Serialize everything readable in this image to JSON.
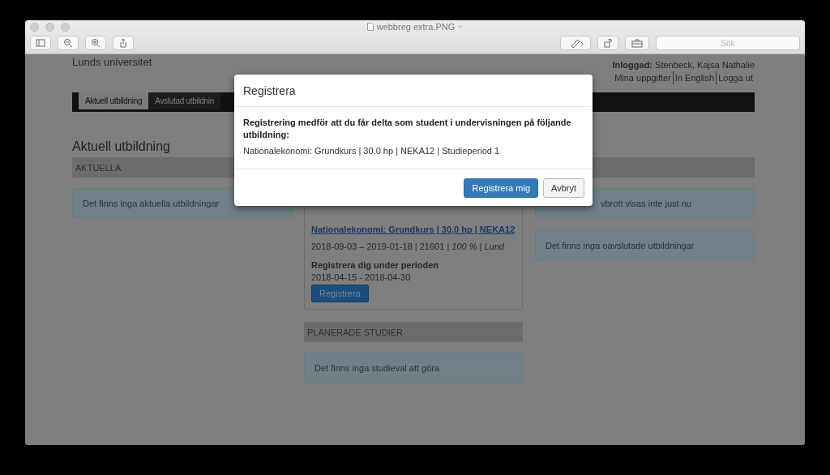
{
  "window": {
    "title": "webbreg extra.PNG",
    "search": {
      "placeholder": "Sök"
    }
  },
  "page": {
    "site_title": "Lunds universitet",
    "login": {
      "text": "**Inloggad:** Stenbeck, Kajsa Nathalie",
      "links": [
        "Mina uppgifter",
        "In English",
        "Logga ut"
      ]
    },
    "tabs": [
      {
        "label": "Aktuell utbildning",
        "selected": true
      },
      {
        "label": "Avslutad utbildnin",
        "selected": false
      }
    ],
    "heading": "Aktuell utbildning",
    "left": {
      "header": "AKTUELLA",
      "notice": "Det finns inga aktuella utbildningar"
    },
    "center": {
      "course": {
        "link": "Nationalekonomi: Grundkurs | 30,0 hp | NEKA12",
        "details": "2018-09-03 – 2019-01-18 | 21601 | *100 %* | *Lund*",
        "period_label": "Registrera dig under perioden",
        "period": "2018-04-15 - 2018-04-30",
        "button": "Registrera"
      },
      "header": "PLANERADE STUDIER",
      "notice": "Det finns inga studieval att göra"
    },
    "right": {
      "notices": [
        "vbrott visas inte just nu",
        "Det finns inga oavslutade utbildningar"
      ]
    }
  },
  "modal": {
    "title": "Registrera",
    "lead": "Registrering medför att du får delta som student i undervisningen på följande utbildning:",
    "course": "Nationalekonomi: Grundkurs | 30.0 hp | NEKA12 | Studieperiod 1",
    "buttons": [
      {
        "label": "Registrera mig",
        "kind": "primary"
      },
      {
        "label": "Avbryt",
        "kind": "default"
      }
    ]
  }
}
